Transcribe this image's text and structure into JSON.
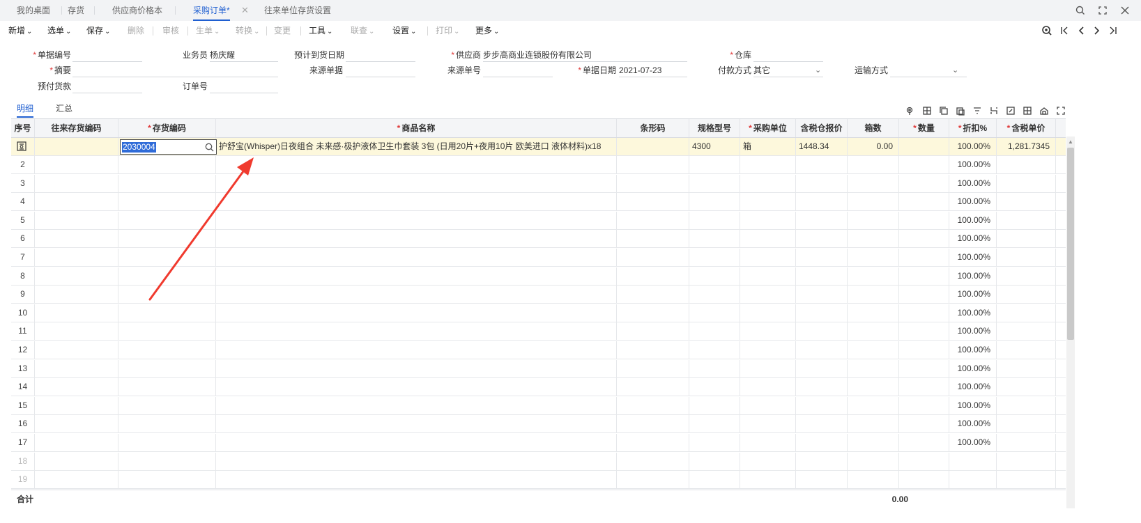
{
  "tabs": [
    {
      "label": "我的桌面",
      "active": false
    },
    {
      "label": "存货",
      "active": false
    },
    {
      "label": "供应商价格本",
      "active": false
    },
    {
      "label": "采购订单",
      "modified_mark": "*",
      "active": true
    },
    {
      "label": "往来单位存货设置",
      "active": false
    }
  ],
  "toolbar": {
    "items": [
      {
        "label": "新增",
        "dropdown": true,
        "disabled": false
      },
      {
        "label": "选单",
        "dropdown": true,
        "disabled": false
      },
      {
        "label": "保存",
        "dropdown": true,
        "disabled": false
      },
      {
        "label": "删除",
        "dropdown": false,
        "disabled": true
      },
      {
        "label": "审核",
        "dropdown": false,
        "disabled": true
      },
      {
        "label": "生单",
        "dropdown": true,
        "disabled": true
      },
      {
        "label": "转换",
        "dropdown": true,
        "disabled": true
      },
      {
        "label": "变更",
        "dropdown": false,
        "disabled": true
      },
      {
        "label": "工具",
        "dropdown": true,
        "disabled": false
      },
      {
        "label": "联查",
        "dropdown": true,
        "disabled": true
      },
      {
        "label": "设置",
        "dropdown": true,
        "disabled": false
      },
      {
        "label": "打印",
        "dropdown": true,
        "disabled": true
      },
      {
        "label": "更多",
        "dropdown": true,
        "disabled": false
      }
    ]
  },
  "form": {
    "doc_no": {
      "label": "单据编号",
      "required": true,
      "value": ""
    },
    "salesman": {
      "label": "业务员",
      "required": false,
      "value": "杨庆耀"
    },
    "expected_date": {
      "label": "预计到货日期",
      "required": false,
      "value": ""
    },
    "supplier": {
      "label": "供应商",
      "required": true,
      "value": "步步高商业连锁股份有限公司"
    },
    "warehouse": {
      "label": "仓库",
      "required": true,
      "value": ""
    },
    "summary": {
      "label": "摘要",
      "required": true,
      "value": ""
    },
    "source_doc": {
      "label": "来源单据",
      "required": false,
      "value": ""
    },
    "source_no": {
      "label": "来源单号",
      "required": false,
      "value": ""
    },
    "doc_date": {
      "label": "单据日期",
      "required": true,
      "value": "2021-07-23"
    },
    "payment": {
      "label": "付款方式",
      "required": false,
      "value": "其它"
    },
    "shipping": {
      "label": "运输方式",
      "required": false,
      "value": ""
    },
    "prepay": {
      "label": "预付货款",
      "required": false,
      "value": ""
    },
    "order_no": {
      "label": "订单号",
      "required": false,
      "value": ""
    }
  },
  "subtabs": [
    {
      "label": "明细",
      "active": true
    },
    {
      "label": "汇总",
      "active": false
    }
  ],
  "grid": {
    "columns": [
      {
        "label": "序号",
        "required": false
      },
      {
        "label": "往来存货编码",
        "required": false
      },
      {
        "label": "存货编码",
        "required": true
      },
      {
        "label": "商品名称",
        "required": true
      },
      {
        "label": "条形码",
        "required": false
      },
      {
        "label": "规格型号",
        "required": false
      },
      {
        "label": "采购单位",
        "required": true
      },
      {
        "label": "含税仓报价",
        "required": false
      },
      {
        "label": "箱数",
        "required": false
      },
      {
        "label": "数量",
        "required": true
      },
      {
        "label": "折扣%",
        "required": true
      },
      {
        "label": "含税单价",
        "required": true
      }
    ],
    "first_row": {
      "stock_code": "2030004",
      "product_name": "护舒宝(Whisper)日夜组合 未来感·极护液体卫生巾套装 3包 (日用20片+夜用10片 欧美进口 液体材料)x18",
      "barcode": "",
      "spec": "4300",
      "unit": "箱",
      "tax_price": "1448.34",
      "boxes": "0.00",
      "qty": "",
      "discount": "100.00%",
      "unit_price": "1,281.7345"
    },
    "rows": [
      {
        "no": "2",
        "discount": "100.00%"
      },
      {
        "no": "3",
        "discount": "100.00%"
      },
      {
        "no": "4",
        "discount": "100.00%"
      },
      {
        "no": "5",
        "discount": "100.00%"
      },
      {
        "no": "6",
        "discount": "100.00%"
      },
      {
        "no": "7",
        "discount": "100.00%"
      },
      {
        "no": "8",
        "discount": "100.00%"
      },
      {
        "no": "9",
        "discount": "100.00%"
      },
      {
        "no": "10",
        "discount": "100.00%"
      },
      {
        "no": "11",
        "discount": "100.00%"
      },
      {
        "no": "12",
        "discount": "100.00%"
      },
      {
        "no": "13",
        "discount": "100.00%"
      },
      {
        "no": "14",
        "discount": "100.00%"
      },
      {
        "no": "15",
        "discount": "100.00%"
      },
      {
        "no": "16",
        "discount": "100.00%"
      },
      {
        "no": "17",
        "discount": "100.00%"
      },
      {
        "no": "18",
        "discount": ""
      },
      {
        "no": "19",
        "discount": ""
      }
    ],
    "total_label": "合计",
    "total_boxes": "0.00"
  },
  "colors": {
    "accent": "#1f5fd1",
    "required": "#e03a3a",
    "selected_row": "#fdf8dc",
    "annotation_arrow": "#f03a2e"
  }
}
